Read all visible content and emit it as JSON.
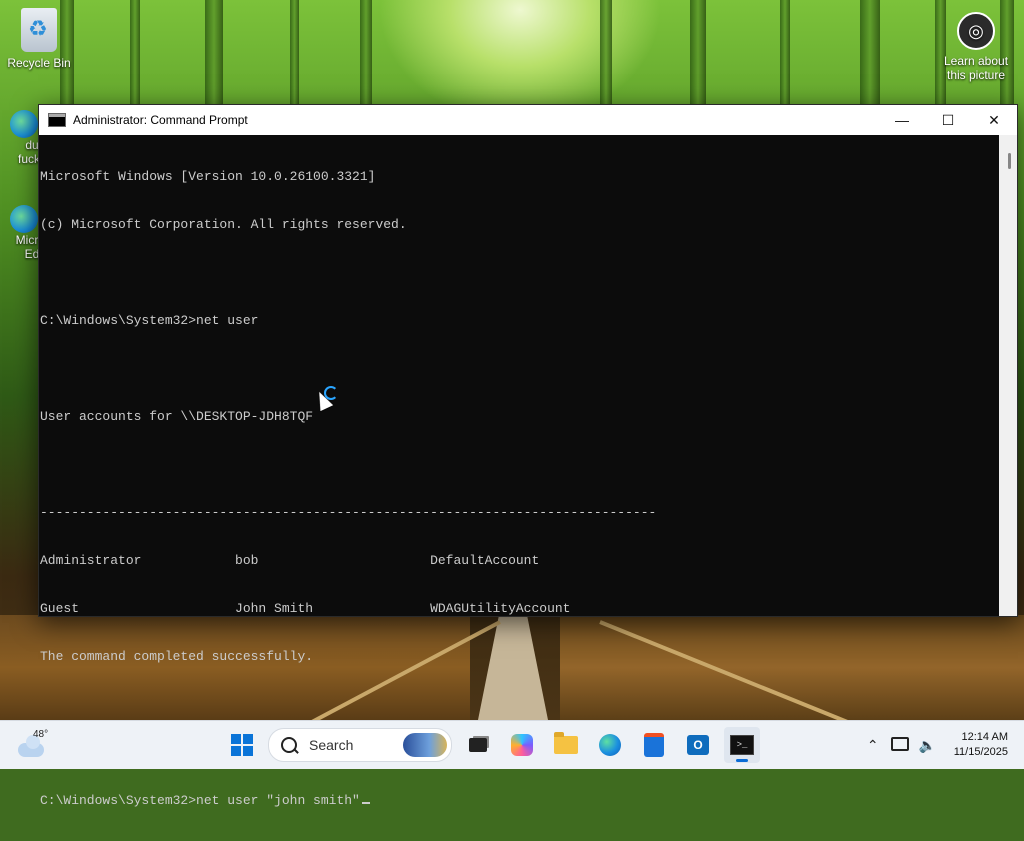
{
  "desktop": {
    "recycle_bin_label": "Recycle Bin",
    "learn_label_1": "Learn about",
    "learn_label_2": "this picture",
    "partial_label_1": "du",
    "partial_label_2": "fuck",
    "partial_label_3": "Micr",
    "partial_label_4": "Ed"
  },
  "window": {
    "title": "Administrator: Command Prompt",
    "minimize_glyph": "—",
    "maximize_glyph": "☐",
    "close_glyph": "✕"
  },
  "terminal": {
    "lines": [
      "Microsoft Windows [Version 10.0.26100.3321]",
      "(c) Microsoft Corporation. All rights reserved.",
      "",
      "C:\\Windows\\System32>net user",
      "",
      "User accounts for \\\\DESKTOP-JDH8TQF",
      "",
      "-------------------------------------------------------------------------------",
      "Administrator            bob                      DefaultAccount",
      "Guest                    John Smith               WDAGUtilityAccount",
      "The command completed successfully.",
      "",
      "",
      "C:\\Windows\\System32>net user \"john smith\""
    ]
  },
  "taskbar": {
    "temperature": "48°",
    "search_label": "Search",
    "clock_time": "12:14 AM",
    "clock_date": "11/15/2025",
    "tray_chevron": "⌃",
    "terminal_glyph": ">_",
    "outlook_letter": "O"
  },
  "icons": {
    "recycle_bin": "recycle-bin-icon",
    "learn_picture": "camera-info-icon",
    "start": "windows-start-icon",
    "search": "search-icon",
    "task_view": "task-view-icon",
    "copilot": "copilot-icon",
    "file_explorer": "folder-icon",
    "edge": "edge-icon",
    "store": "store-icon",
    "outlook": "outlook-icon",
    "terminal": "command-prompt-icon"
  },
  "colors": {
    "terminal_bg": "#0c0c0c",
    "terminal_fg": "#cccccc",
    "accent": "#0a6cd6"
  }
}
